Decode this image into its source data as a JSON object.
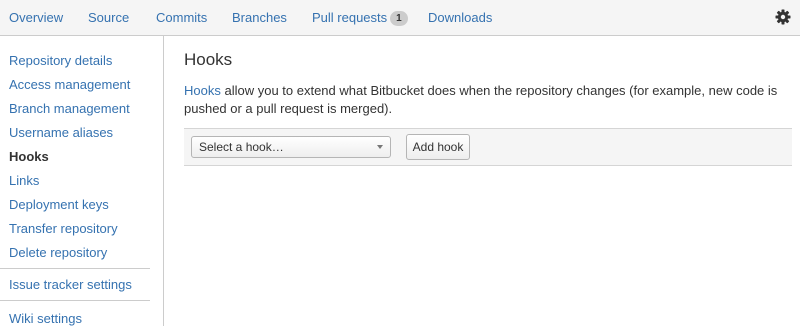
{
  "tabs": [
    {
      "label": "Overview"
    },
    {
      "label": "Source"
    },
    {
      "label": "Commits"
    },
    {
      "label": "Branches"
    },
    {
      "label": "Pull requests",
      "badge": "1"
    },
    {
      "label": "Downloads"
    }
  ],
  "settings_icon": "gear-icon",
  "sidebar": {
    "items": [
      {
        "label": "Repository details"
      },
      {
        "label": "Access management"
      },
      {
        "label": "Branch management"
      },
      {
        "label": "Username aliases"
      },
      {
        "label": "Hooks",
        "active": true
      },
      {
        "label": "Links"
      },
      {
        "label": "Deployment keys"
      },
      {
        "label": "Transfer repository"
      },
      {
        "label": "Delete repository"
      },
      {
        "label": "Issue tracker settings"
      },
      {
        "label": "Wiki settings"
      }
    ]
  },
  "main": {
    "title": "Hooks",
    "description_link": "Hooks",
    "description_text": " allow you to extend what Bitbucket does when the repository changes (for example, new code is pushed or a pull request is merged).",
    "select_value": "Select a hook…",
    "add_button": "Add hook"
  },
  "colors": {
    "link": "#3572b0",
    "text": "#333333",
    "bar_background": "#f5f5f5",
    "border": "#cccccc"
  }
}
